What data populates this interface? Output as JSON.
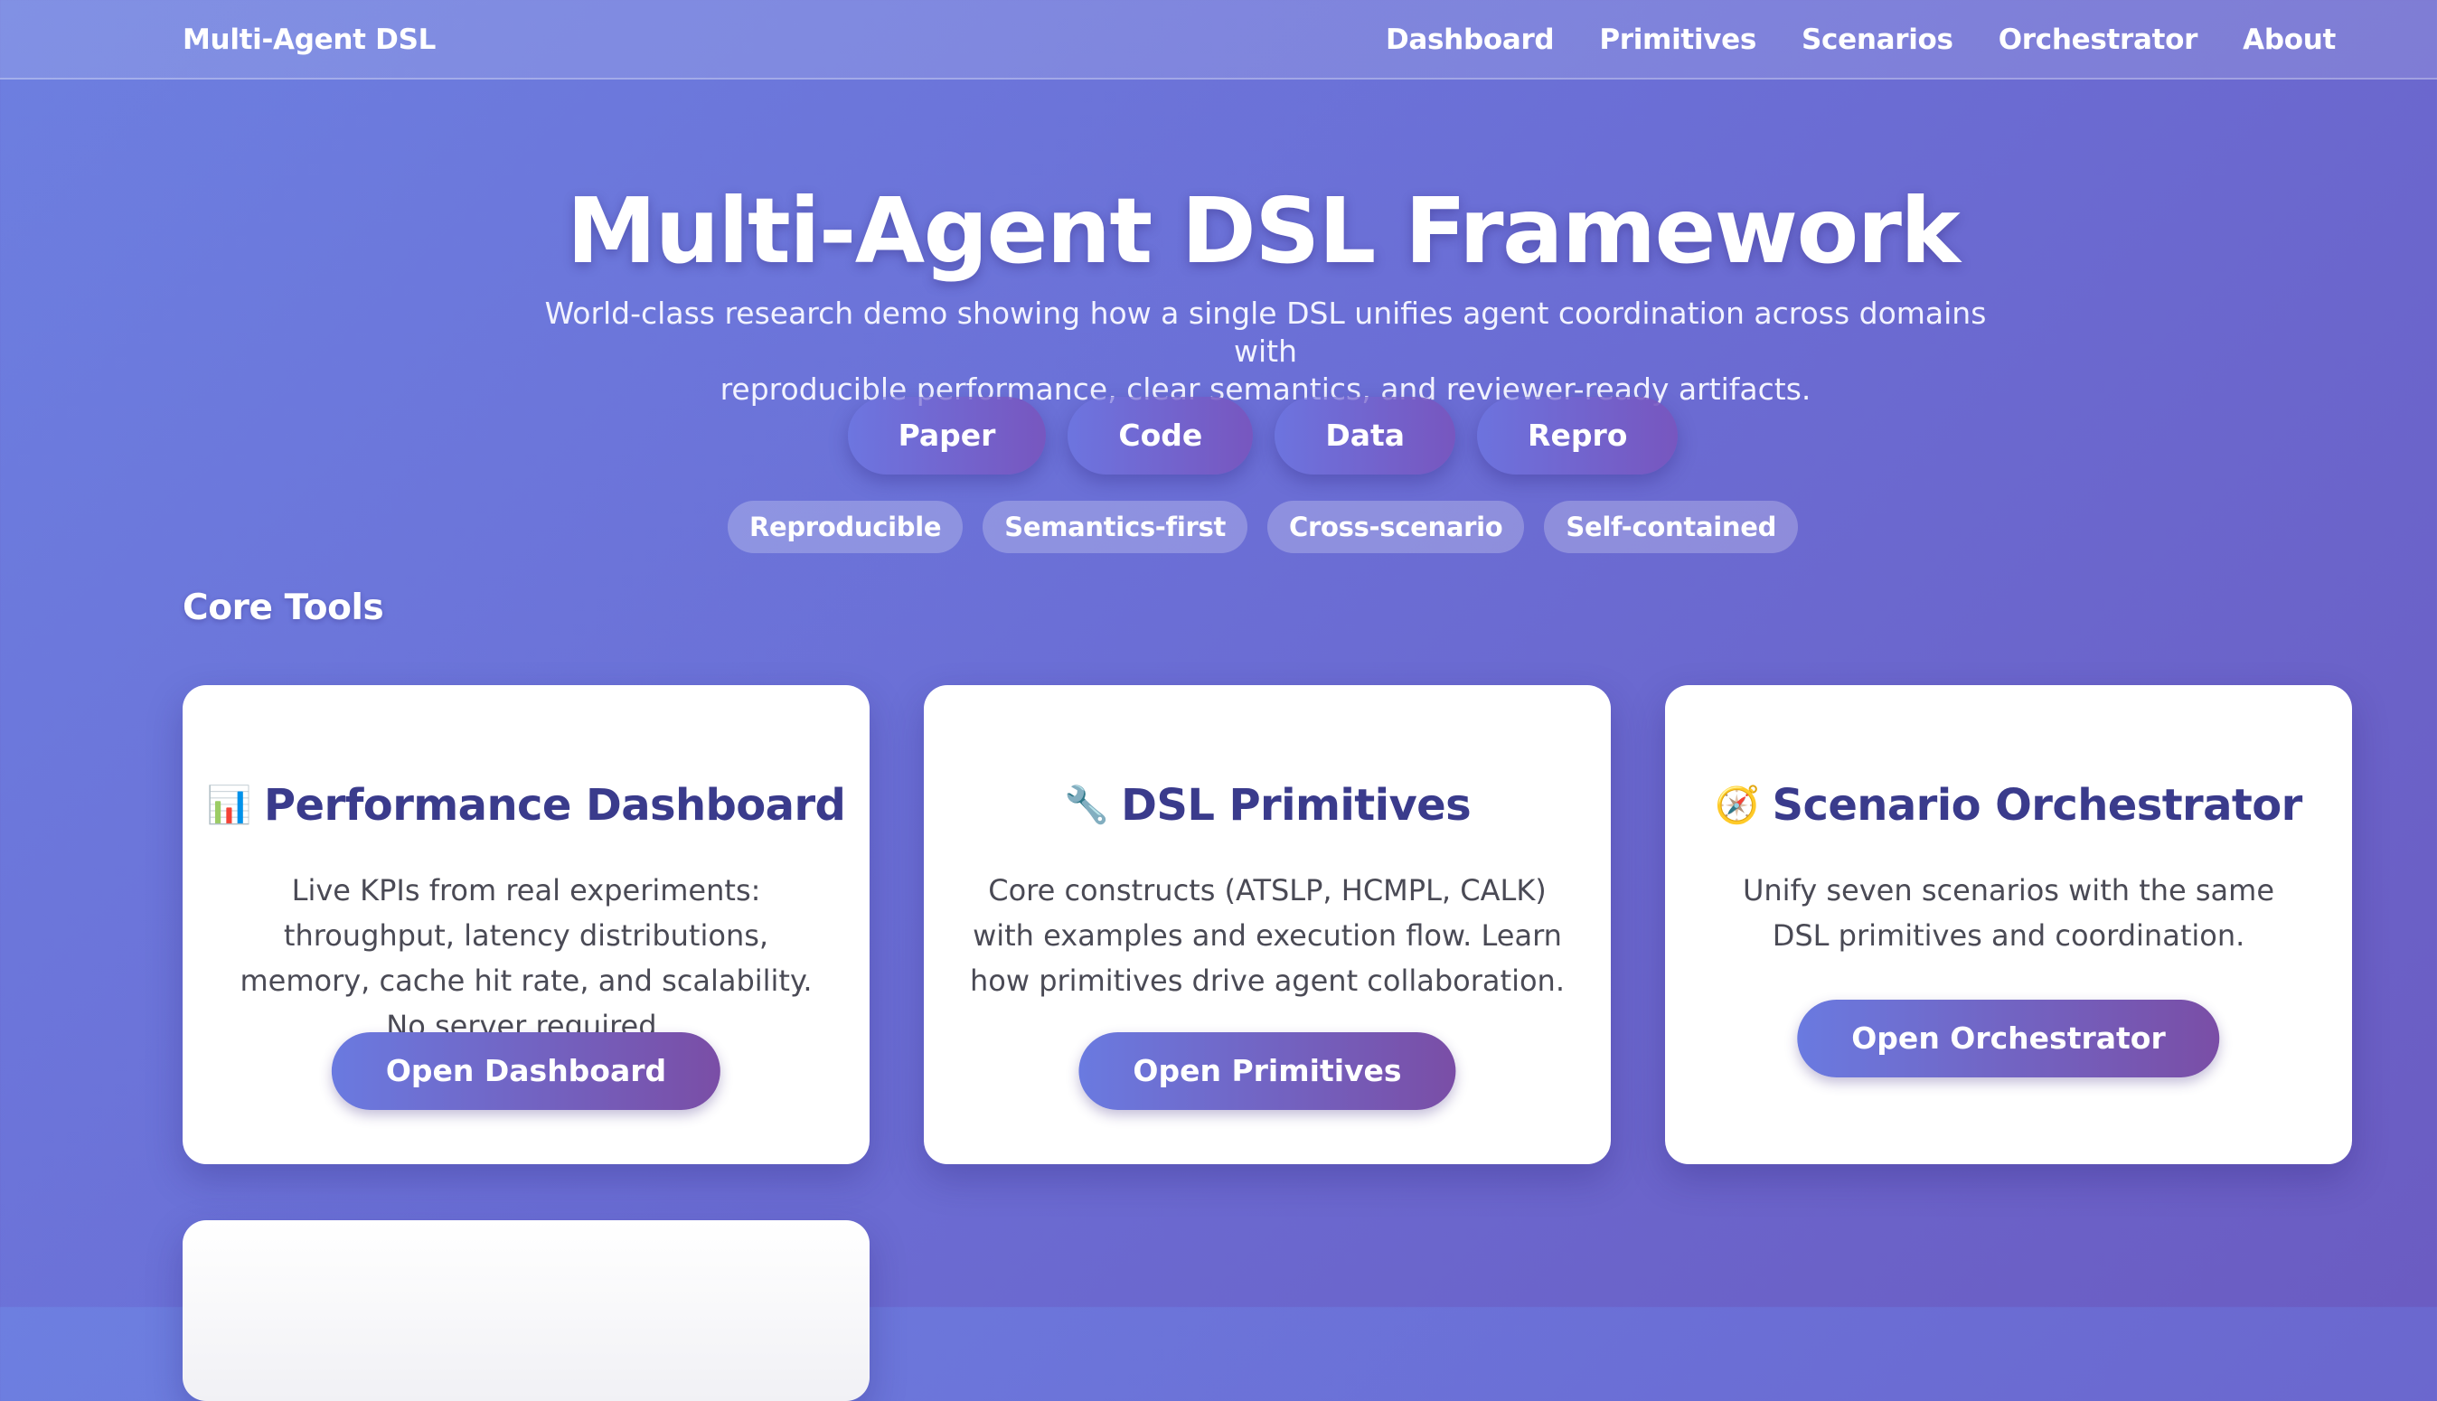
{
  "nav": {
    "brand": "Multi-Agent DSL",
    "links": [
      "Dashboard",
      "Primitives",
      "Scenarios",
      "Orchestrator",
      "About"
    ]
  },
  "hero": {
    "title": "Multi-Agent DSL Framework",
    "subtitle_line1": "World-class research demo showing how a single DSL unifies agent coordination across domains with",
    "subtitle_line2": "reproducible performance, clear semantics, and reviewer-ready artifacts.",
    "buttons": [
      "Paper",
      "Code",
      "Data",
      "Repro"
    ],
    "tags": [
      "Reproducible",
      "Semantics-first",
      "Cross-scenario",
      "Self-contained"
    ]
  },
  "section": {
    "title": "Core Tools"
  },
  "cards": [
    {
      "icon": "📊",
      "icon_name": "bar-chart-icon",
      "title": "Performance Dashboard",
      "description": "Live KPIs from real experiments: throughput, latency distributions, memory, cache hit rate, and scalability. No server required.",
      "button": "Open Dashboard"
    },
    {
      "icon": "🔧",
      "icon_name": "wrench-icon",
      "title": "DSL Primitives",
      "description": "Core constructs (ATSLP, HCMPL, CALK) with examples and execution flow. Learn how primitives drive agent collaboration.",
      "button": "Open Primitives"
    },
    {
      "icon": "🧭",
      "icon_name": "compass-icon",
      "title": "Scenario Orchestrator",
      "description": "Unify seven scenarios with the same DSL primitives and coordination.",
      "button": "Open Orchestrator"
    }
  ],
  "colors": {
    "background_start": "#6d7fe0",
    "background_end": "#6b5cc2",
    "card_title": "#3a3b8c",
    "button_start": "#6a7ae0",
    "button_end": "#7a4ea6"
  }
}
